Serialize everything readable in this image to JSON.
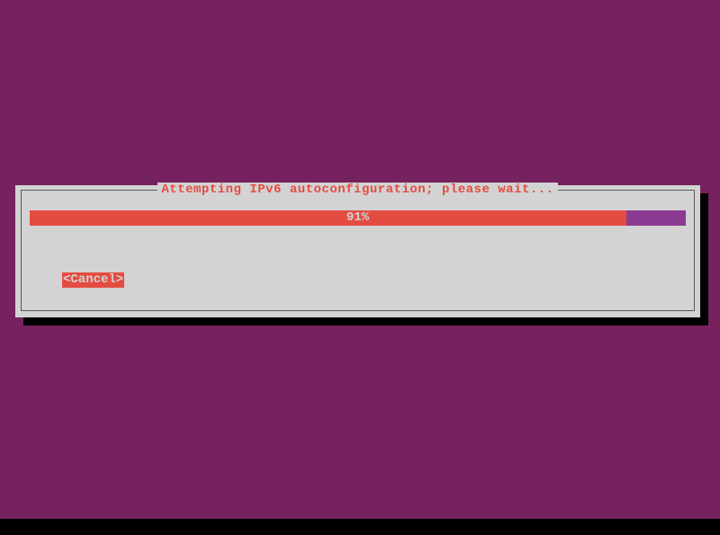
{
  "dialog": {
    "title": "Attempting IPv6 autoconfiguration; please wait...",
    "progress": {
      "percent": 91,
      "label": "91%"
    },
    "cancel_label": "<Cancel>"
  },
  "colors": {
    "background": "#75225f",
    "dialog_bg": "#d3d3d3",
    "accent": "#e44c42",
    "progress_remaining": "#8d3a93",
    "shadow": "#000"
  }
}
